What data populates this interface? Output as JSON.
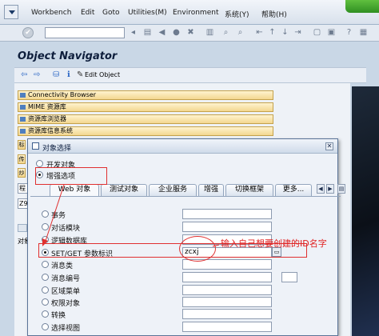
{
  "menu": [
    {
      "label": "Workbench",
      "key": "W"
    },
    {
      "label": "Edit",
      "key": "E"
    },
    {
      "label": "Goto",
      "key": "G"
    },
    {
      "label": "Utilities(M)",
      "key": "U"
    },
    {
      "label": "Environment",
      "key": "n"
    },
    {
      "label": "系统(Y)",
      "key": ""
    },
    {
      "label": "帮助(H)",
      "key": ""
    }
  ],
  "app_title": "Object Navigator",
  "toolbar2": {
    "edit_object": "Edit Object"
  },
  "left_panel": {
    "buttons": [
      "Connectivity Browser",
      "MIME 资源库",
      "资源库浏览器",
      "资源库信息系统"
    ],
    "small_labels": [
      "标",
      "传",
      "炒"
    ],
    "fields": [
      "程",
      "Z9"
    ],
    "objects_label": "对象"
  },
  "dialog": {
    "title": "对象选择",
    "radio_top": [
      {
        "label": "开发对象",
        "selected": false
      },
      {
        "label": "增强选项",
        "selected": true
      }
    ],
    "tabs": [
      "Web 对象",
      "测试对象",
      "企业服务",
      "增强",
      "切换框架",
      "更多..."
    ],
    "options": [
      {
        "label": "事务",
        "value": "",
        "selected": false
      },
      {
        "label": "对话模块",
        "value": "",
        "selected": false
      },
      {
        "label": "逻辑数据库",
        "value": "",
        "selected": false
      },
      {
        "label": "SET/GET 参数标识",
        "value": "zcxj",
        "selected": true
      },
      {
        "label": "消息类",
        "value": "",
        "selected": false
      },
      {
        "label": "消息编号",
        "value": "",
        "selected": false
      },
      {
        "label": "区域菜单",
        "value": "",
        "selected": false
      },
      {
        "label": "权限对象",
        "value": "",
        "selected": false
      },
      {
        "label": "转换",
        "value": "",
        "selected": false
      },
      {
        "label": "选择视图",
        "value": "",
        "selected": false
      }
    ]
  },
  "annotation": "输入自己想要创建的ID名字",
  "colors": {
    "annotation": "#e02020",
    "accent": "#2c67c5"
  }
}
